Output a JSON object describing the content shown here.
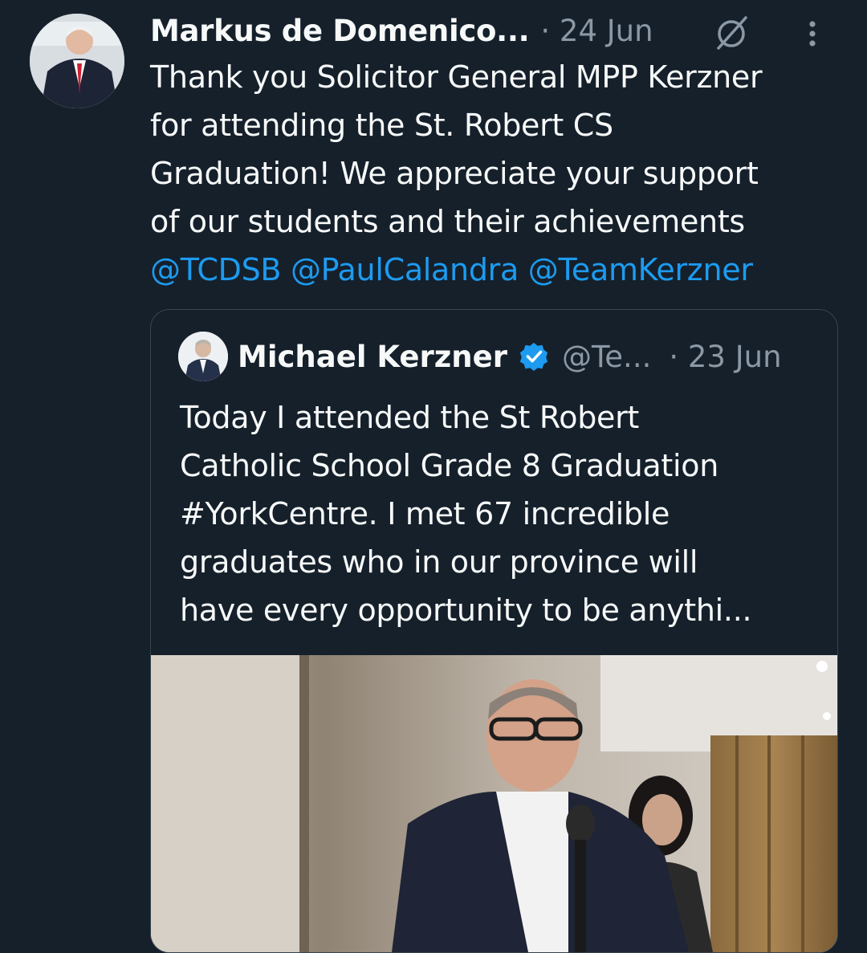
{
  "tweet": {
    "author_name": "Markus de Domenico...",
    "timestamp": "· 24 Jun",
    "text_lines": [
      "Thank you Solicitor General MPP Kerzner",
      "for attending the St. Robert CS",
      "Graduation! We appreciate your support",
      "of our students and their achievements"
    ],
    "mentions": "@TCDSB @PaulCalandra @TeamKerzner"
  },
  "quoted_tweet": {
    "author_name": "Michael Kerzner",
    "handle": "@Te...",
    "timestamp": "· 23 Jun",
    "text_lines": [
      "Today I attended the St Robert",
      "Catholic School Grade 8 Graduation",
      "#YorkCentre. I met 67 incredible",
      "graduates who in our province will",
      "have every opportunity to be anythi..."
    ]
  },
  "icons": {
    "mute": "mute-icon",
    "more": "more-options-icon",
    "verified": "verified-badge-icon"
  },
  "colors": {
    "background": "#15202b",
    "text": "#f7f9f9",
    "secondary_text": "#8b98a5",
    "link": "#1d9bf0",
    "border": "#38444d"
  }
}
